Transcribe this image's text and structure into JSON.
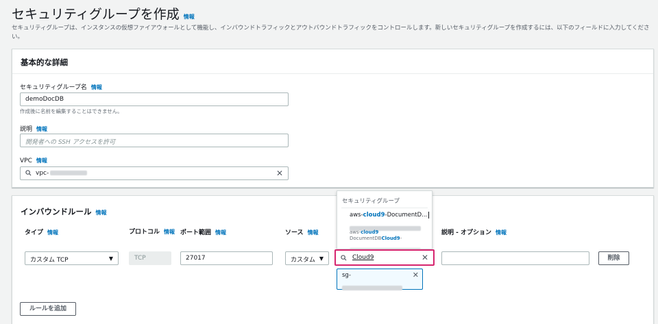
{
  "page": {
    "title": "セキュリティグループを作成",
    "title_info": "情報",
    "description": "セキュリティグループは、インスタンスの仮想ファイアウォールとして機能し、インバウンドトラフィックとアウトバウンドトラフィックをコントロールします。新しいセキュリティグループを作成するには、以下のフィールドに入力してください。"
  },
  "basic": {
    "header": "基本的な詳細",
    "name_label": "セキュリティグループ名",
    "name_info": "情報",
    "name_value": "demoDocDB",
    "name_hint": "作成後に名前を編集することはできません。",
    "desc_label": "説明",
    "desc_info": "情報",
    "desc_placeholder": "開発者への SSH アクセスを許可",
    "vpc_label": "VPC",
    "vpc_info": "情報",
    "vpc_value": "vpc-",
    "vpc_clear": "✕"
  },
  "inbound": {
    "header": "インバウンドルール",
    "header_info": "情報",
    "columns": {
      "type": "タイプ",
      "type_info": "情報",
      "protocol": "プロトコル",
      "protocol_info": "情報",
      "port": "ポート範囲",
      "port_info": "情報",
      "source": "ソース",
      "source_info": "情報",
      "desc": "説明 - オプション",
      "desc_info": "情報"
    },
    "row": {
      "type": "カスタム TCP",
      "protocol": "TCP",
      "port": "27017",
      "source_type": "カスタム",
      "search_value": "Cloud9",
      "delete": "削除"
    },
    "add_rule": "ルールを追加"
  },
  "dropdown": {
    "group_label": "セキュリティグループ",
    "item1_prefix": "aws-",
    "item1_highlight": "cloud9",
    "item1_suffix": "-DocumentD...",
    "item2_prefix": "aws-",
    "item2_highlight": "cloud9",
    "item2_line2_prefix": "DocumentDB",
    "item2_line2_highlight": "Cloud9",
    "item2_line2_suffix": "-"
  },
  "token": {
    "label": "sg-",
    "close": "✕"
  },
  "colors": {
    "link": "#0073bb",
    "focus": "#d6246e"
  }
}
